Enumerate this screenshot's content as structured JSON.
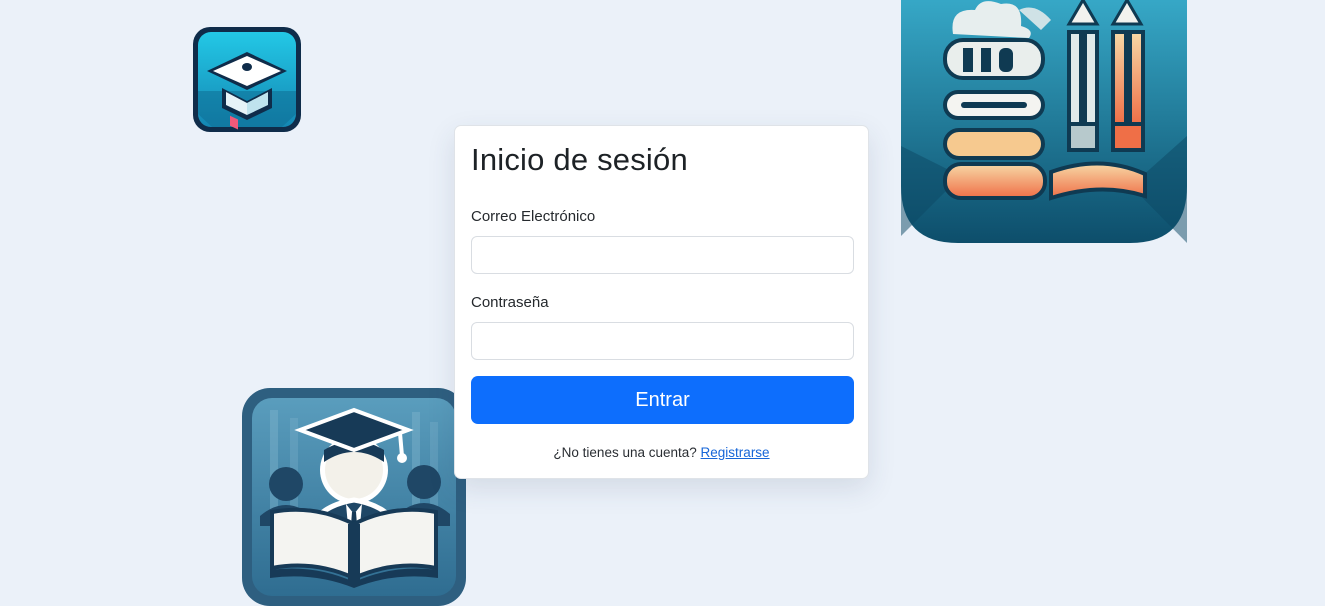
{
  "login": {
    "title": "Inicio de sesión",
    "email_label": "Correo Electrónico",
    "email_value": "",
    "password_label": "Contraseña",
    "password_value": "",
    "submit_label": "Entrar",
    "register_prompt": "¿No tienes una cuenta?",
    "register_link": "Registrarse"
  },
  "colors": {
    "page_background": "#ebf1f9",
    "primary": "#0d6efd",
    "link": "#1666d8"
  },
  "decorations": [
    {
      "icon": "graduation-cap-app-icon"
    },
    {
      "icon": "books-and-pencils-illustration"
    },
    {
      "icon": "student-reading-book-illustration"
    }
  ]
}
